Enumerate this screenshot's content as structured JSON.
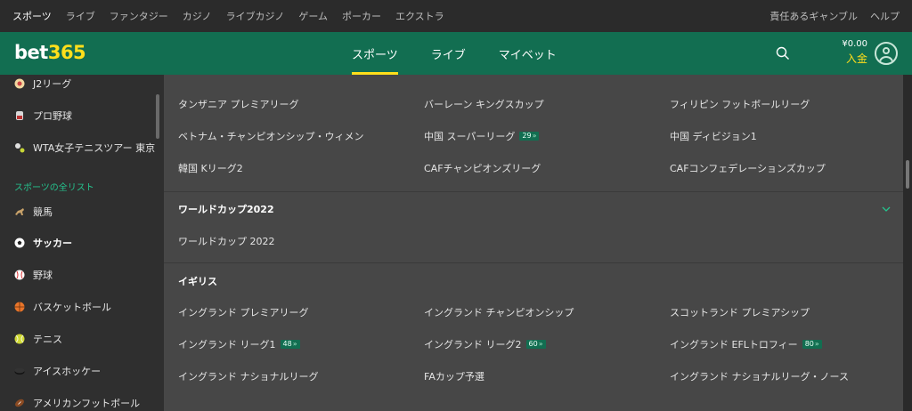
{
  "topbar": {
    "left": [
      "スポーツ",
      "ライブ",
      "ファンタジー",
      "カジノ",
      "ライブカジノ",
      "ゲーム",
      "ポーカー",
      "エクストラ"
    ],
    "right": [
      "責任あるギャンブル",
      "ヘルプ"
    ]
  },
  "header": {
    "logo_text": "bet",
    "logo_num": "365",
    "nav": [
      "スポーツ",
      "ライブ",
      "マイベット"
    ],
    "balance": "¥0.00",
    "deposit": "入金"
  },
  "sidebar": {
    "items_top": [
      {
        "label": "J2リーグ",
        "icon": "j2-league-icon"
      },
      {
        "label": "プロ野球",
        "icon": "pro-baseball-icon"
      },
      {
        "label": "WTA女子テニスツアー 東京",
        "icon": "tennis-ball-icon"
      }
    ],
    "section": "スポーツの全リスト",
    "items": [
      {
        "label": "競馬",
        "icon": "horse-racing-icon"
      },
      {
        "label": "サッカー",
        "icon": "soccer-ball-icon"
      },
      {
        "label": "野球",
        "icon": "baseball-icon"
      },
      {
        "label": "バスケットボール",
        "icon": "basketball-icon"
      },
      {
        "label": "テニス",
        "icon": "tennis-icon"
      },
      {
        "label": "アイスホッケー",
        "icon": "hockey-puck-icon"
      },
      {
        "label": "アメリカンフットボール",
        "icon": "american-football-icon"
      }
    ]
  },
  "main": {
    "rows_top": [
      [
        "タンザニア プレミアリーグ",
        "バーレーン キングスカップ",
        "フィリピン フットボールリーグ"
      ],
      [
        "ベトナム・チャンピオンシップ・ウィメン",
        "中国 スーパーリーグ",
        "中国 ディビジョン1"
      ],
      [
        "韓国 Kリーグ2",
        "CAFチャンピオンズリーグ",
        "CAFコンフェデレーションズカップ"
      ]
    ],
    "badge_china_super": "29",
    "section_worldcup": "ワールドカップ2022",
    "worldcup_item": "ワールドカップ 2022",
    "section_uk": "イギリス",
    "rows_uk": [
      [
        "イングランド プレミアリーグ",
        "イングランド チャンピオンシップ",
        "スコットランド プレミアシップ"
      ],
      [
        "イングランド リーグ1",
        "イングランド リーグ2",
        "イングランド EFLトロフィー"
      ],
      [
        "イングランド ナショナルリーグ",
        "FAカップ予選",
        "イングランド ナショナルリーグ・ノース"
      ]
    ],
    "badges_uk": [
      "48",
      "60",
      "80"
    ]
  },
  "colors": {
    "brand_green": "#126e51",
    "accent_yellow": "#ffdf1b",
    "section_green": "#25c28d"
  }
}
